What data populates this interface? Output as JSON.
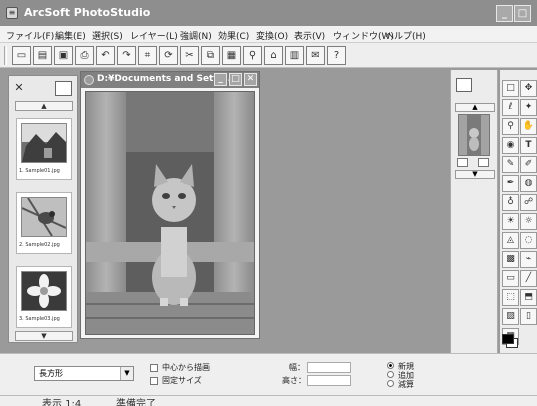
{
  "app": {
    "title": "ArcSoft PhotoStudio"
  },
  "menu": [
    {
      "label": "ファイル(F)"
    },
    {
      "label": "編集(E)"
    },
    {
      "label": "選択(S)"
    },
    {
      "label": "レイヤー(L)"
    },
    {
      "label": "強調(N)"
    },
    {
      "label": "効果(C)"
    },
    {
      "label": "変換(O)"
    },
    {
      "label": "表示(V)"
    },
    {
      "label": "ウィンドウ(W)"
    },
    {
      "label": "ヘルプ(H)"
    }
  ],
  "toolbar": {
    "buttons": [
      "new-icon",
      "open-icon",
      "save-icon",
      "print-icon",
      "undo-icon",
      "redo-icon",
      "crop-icon",
      "rotate-icon",
      "cut-icon",
      "copy-icon",
      "paste-icon",
      "zoom-icon",
      "acquire-icon",
      "slideshow-icon",
      "email-icon",
      "help-icon"
    ],
    "help_glyph": "?"
  },
  "thumbnails": {
    "items": [
      {
        "label": "1. Sample01.jpg"
      },
      {
        "label": "2. Sample02.jpg"
      },
      {
        "label": "3. Sample03.jpg"
      }
    ]
  },
  "document": {
    "title": "D:¥Documents and Setti..."
  },
  "options": {
    "shape_select": "長方形",
    "draw_from_center": "中心から描画",
    "fixed_size": "固定サイズ",
    "width_label": "幅：",
    "height_label": "高さ：",
    "mode_new": "新規",
    "mode_add": "追加",
    "mode_subtract": "減算"
  },
  "status": {
    "zoom": "表示 1:4",
    "state": "準備完了"
  },
  "colors": {
    "titlebar": "#8e8e8e",
    "workspace": "#9a9a9a"
  }
}
